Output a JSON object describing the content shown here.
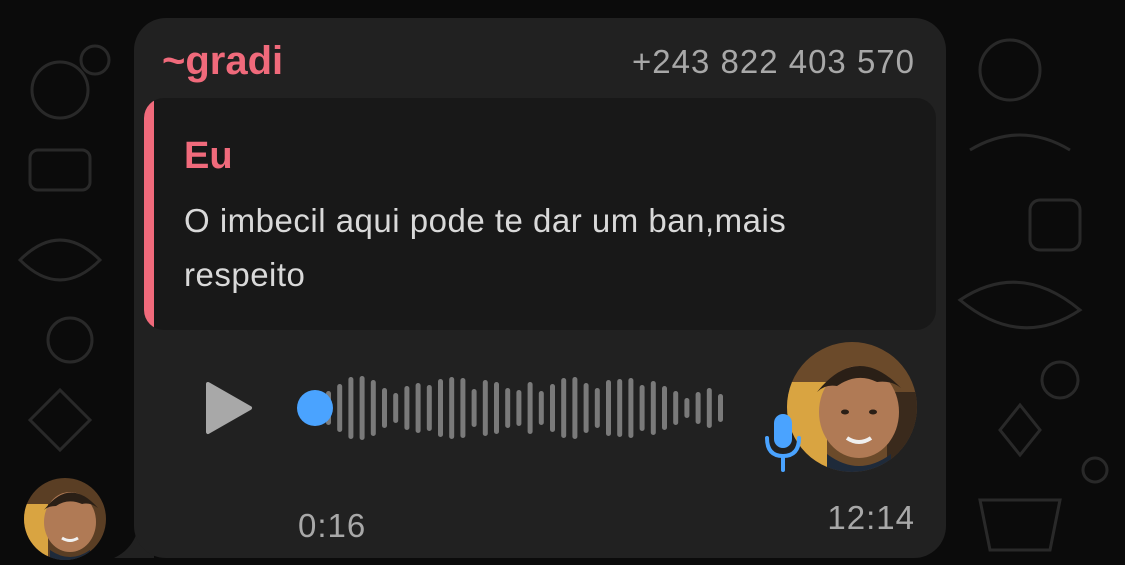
{
  "message": {
    "sender_name": "~gradi",
    "sender_phone": "+243 822 403 570",
    "quoted": {
      "author": "Eu",
      "text": "O imbecil aqui pode te dar um ban,mais respeito"
    },
    "voice_note": {
      "duration": "0:16",
      "progress": 0,
      "play_icon": "play-icon",
      "mic_icon": "microphone-icon"
    },
    "time": "12:14"
  },
  "colors": {
    "background": "#0b0b0b",
    "bubble": "#212121",
    "quote_background": "#181818",
    "accent_name": "#f06a7b",
    "progress_blue": "#4aa3ff",
    "meta_text": "#a8a8a8",
    "waveform": "#7a7a7a"
  }
}
